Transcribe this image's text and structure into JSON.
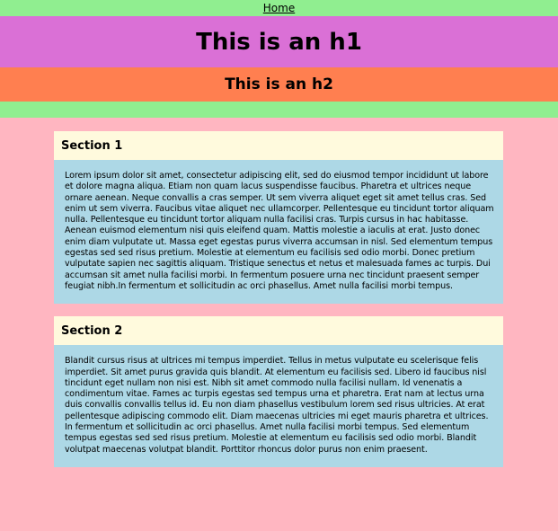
{
  "nav": {
    "home_label": "Home"
  },
  "headings": {
    "h1": "This is an h1",
    "h2": "This is an h2"
  },
  "sections": [
    {
      "title": "Section 1",
      "body": "Lorem ipsum dolor sit amet, consectetur adipiscing elit, sed do eiusmod tempor incididunt ut labore et dolore magna aliqua. Etiam non quam lacus suspendisse faucibus. Pharetra et ultrices neque ornare aenean. Neque convallis a cras semper. Ut sem viverra aliquet eget sit amet tellus cras. Sed enim ut sem viverra. Faucibus vitae aliquet nec ullamcorper. Pellentesque eu tincidunt tortor aliquam nulla. Pellentesque eu tincidunt tortor aliquam nulla facilisi cras. Turpis cursus in hac habitasse. Aenean euismod elementum nisi quis eleifend quam. Mattis molestie a iaculis at erat. Justo donec enim diam vulputate ut. Massa eget egestas purus viverra accumsan in nisl. Sed elementum tempus egestas sed sed risus pretium. Molestie at elementum eu facilisis sed odio morbi. Donec pretium vulputate sapien nec sagittis aliquam. Tristique senectus et netus et malesuada fames ac turpis. Dui accumsan sit amet nulla facilisi morbi. In fermentum posuere urna nec tincidunt praesent semper feugiat nibh.In fermentum et sollicitudin ac orci phasellus. Amet nulla facilisi morbi tempus."
    },
    {
      "title": "Section 2",
      "body": "Blandit cursus risus at ultrices mi tempus imperdiet. Tellus in metus vulputate eu scelerisque felis imperdiet. Sit amet purus gravida quis blandit. At elementum eu facilisis sed. Libero id faucibus nisl tincidunt eget nullam non nisi est. Nibh sit amet commodo nulla facilisi nullam. Id venenatis a condimentum vitae. Fames ac turpis egestas sed tempus urna et pharetra. Erat nam at lectus urna duis convallis convallis tellus id. Eu non diam phasellus vestibulum lorem sed risus ultricies. At erat pellentesque adipiscing commodo elit. Diam maecenas ultricies mi eget mauris pharetra et ultrices. In fermentum et sollicitudin ac orci phasellus. Amet nulla facilisi morbi tempus. Sed elementum tempus egestas sed sed risus pretium. Molestie at elementum eu facilisis sed odio morbi. Blandit volutpat maecenas volutpat blandit. Porttitor rhoncus dolor purus non enim praesent."
    }
  ],
  "colors": {
    "page_background": "#ffb6c1",
    "nav_background": "#90ee90",
    "h1_background": "#da70d6",
    "h2_background": "#ff7f50",
    "section_header_background": "#fffadd",
    "section_body_background": "#add8e6"
  }
}
